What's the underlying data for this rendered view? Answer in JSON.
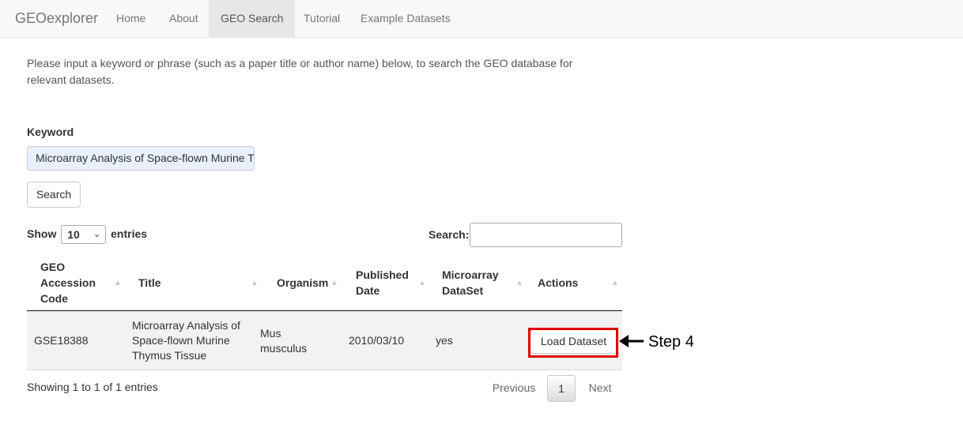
{
  "navbar": {
    "brand": "GEOexplorer",
    "items": [
      {
        "label": "Home",
        "active": false
      },
      {
        "label": "About",
        "active": false
      },
      {
        "label": "GEO Search",
        "active": true
      },
      {
        "label": "Tutorial",
        "active": false
      },
      {
        "label": "Example Datasets",
        "active": false
      }
    ]
  },
  "intro": "Please input a keyword or phrase (such as a paper title or author name) below, to search the GEO database for relevant datasets.",
  "keyword": {
    "label": "Keyword",
    "value": "Microarray Analysis of Space-flown Murine Thymus Tissue"
  },
  "search_button": "Search",
  "table_controls": {
    "show_label": "Show",
    "entries_value": "10",
    "entries_label": "entries",
    "search_label": "Search:"
  },
  "table": {
    "headers": [
      "GEO Accession Code",
      "Title",
      "Organism",
      "Published Date",
      "Microarray DataSet",
      "Actions"
    ],
    "rows": [
      {
        "accession": "GSE18388",
        "title": "Microarray Analysis of Space-flown Murine Thymus Tissue",
        "organism": "Mus musculus",
        "date": "2010/03/10",
        "microarray": "yes",
        "action": "Load Dataset"
      }
    ]
  },
  "info": "Showing 1 to 1 of 1 entries",
  "pagination": {
    "previous": "Previous",
    "current": "1",
    "next": "Next"
  },
  "annotation": {
    "label": "Step 4",
    "color": "#e00000"
  }
}
